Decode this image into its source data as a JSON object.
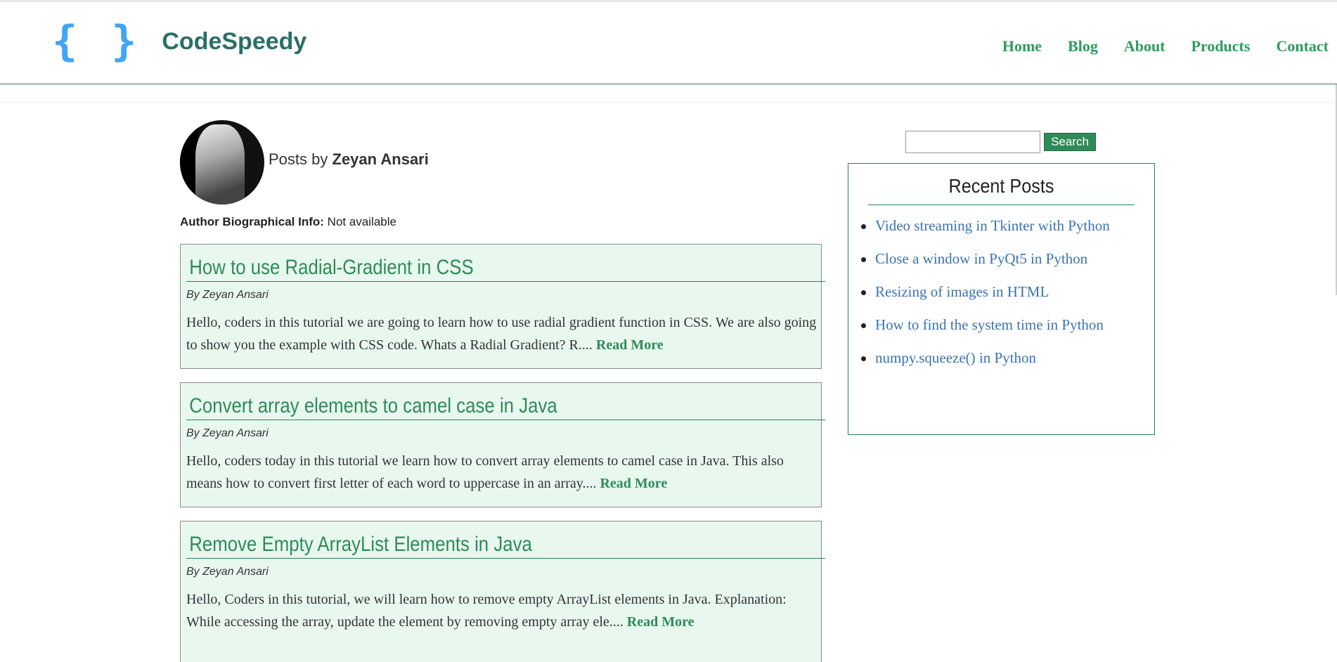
{
  "header": {
    "logo_braces": "{ }",
    "site_name": "CodeSpeedy",
    "nav": [
      {
        "label": "Home"
      },
      {
        "label": "Blog"
      },
      {
        "label": "About"
      },
      {
        "label": "Products"
      },
      {
        "label": "Contact"
      }
    ]
  },
  "author": {
    "posts_by_prefix": "Posts by",
    "name": "Zeyan Ansari",
    "bio_label": "Author Biographical Info:",
    "bio_value": "Not available"
  },
  "posts": [
    {
      "title": "How to use Radial-Gradient in CSS",
      "byline": "By Zeyan Ansari",
      "excerpt": "Hello, coders in this tutorial we are going to learn how to use radial gradient function in CSS. We are also going to show you the example with CSS code. Whats a Radial Gradient? R.... ",
      "read_more": "Read More"
    },
    {
      "title": "Convert array elements to camel case in Java",
      "byline": "By Zeyan Ansari",
      "excerpt": "Hello, coders today in this tutorial we learn how to convert array elements to camel case in Java. This also means how to convert first letter of each word to uppercase in an array.... ",
      "read_more": "Read More"
    },
    {
      "title": "Remove Empty ArrayList Elements in Java",
      "byline": "By Zeyan Ansari",
      "excerpt": "Hello, Coders in this tutorial, we will learn how to remove empty ArrayList elements in Java. Explanation: While accessing the array, update the element by removing empty array ele.... ",
      "read_more": "Read More"
    }
  ],
  "sidebar": {
    "search_value": "",
    "search_button": "Search",
    "recent_title": "Recent Posts",
    "recent_posts": [
      "Video streaming in Tkinter with Python",
      "Close a window in PyQt5 in Python",
      "Resizing of images in HTML",
      "How to find the system time in Python",
      "numpy.squeeze() in Python"
    ]
  },
  "colors": {
    "accent_green": "#2e8b57",
    "logo_blue": "#42a5f5",
    "link_blue": "#3b73b3",
    "card_bg": "#e8f8ef"
  }
}
